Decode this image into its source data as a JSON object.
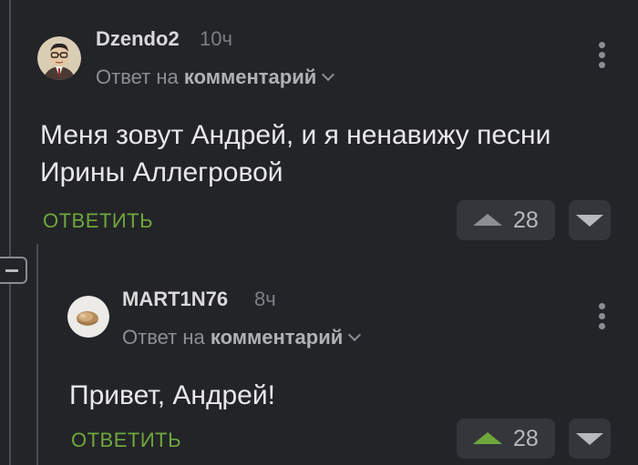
{
  "comments": [
    {
      "username": "Dzendo2",
      "time": "10ч",
      "reply_prefix": "Ответ на",
      "reply_link": "комментарий",
      "text": "Меня зовут Андрей, и я ненавижу песни Ирины Аллегровой",
      "reply_label": "ОТВЕТИТЬ",
      "rating": "28",
      "upvoted": false,
      "avatar": "man-glasses-avatar"
    },
    {
      "username": "MART1N76",
      "time": "8ч",
      "reply_prefix": "Ответ на",
      "reply_link": "комментарий",
      "text": "Привет, Андрей!",
      "reply_label": "ОТВЕТИТЬ",
      "rating": "28",
      "upvoted": true,
      "avatar": "bread-avatar"
    }
  ],
  "icons": {
    "more": "more-vertical-icon",
    "collapse": "collapse-minus-icon",
    "upvote": "upvote-triangle-icon",
    "downvote": "downvote-triangle-icon",
    "chevron": "chevron-down-icon"
  },
  "colors": {
    "background": "#232428",
    "accent_green": "#6ea83c",
    "button_bg": "#34363b",
    "muted_text": "#8c8e93"
  }
}
